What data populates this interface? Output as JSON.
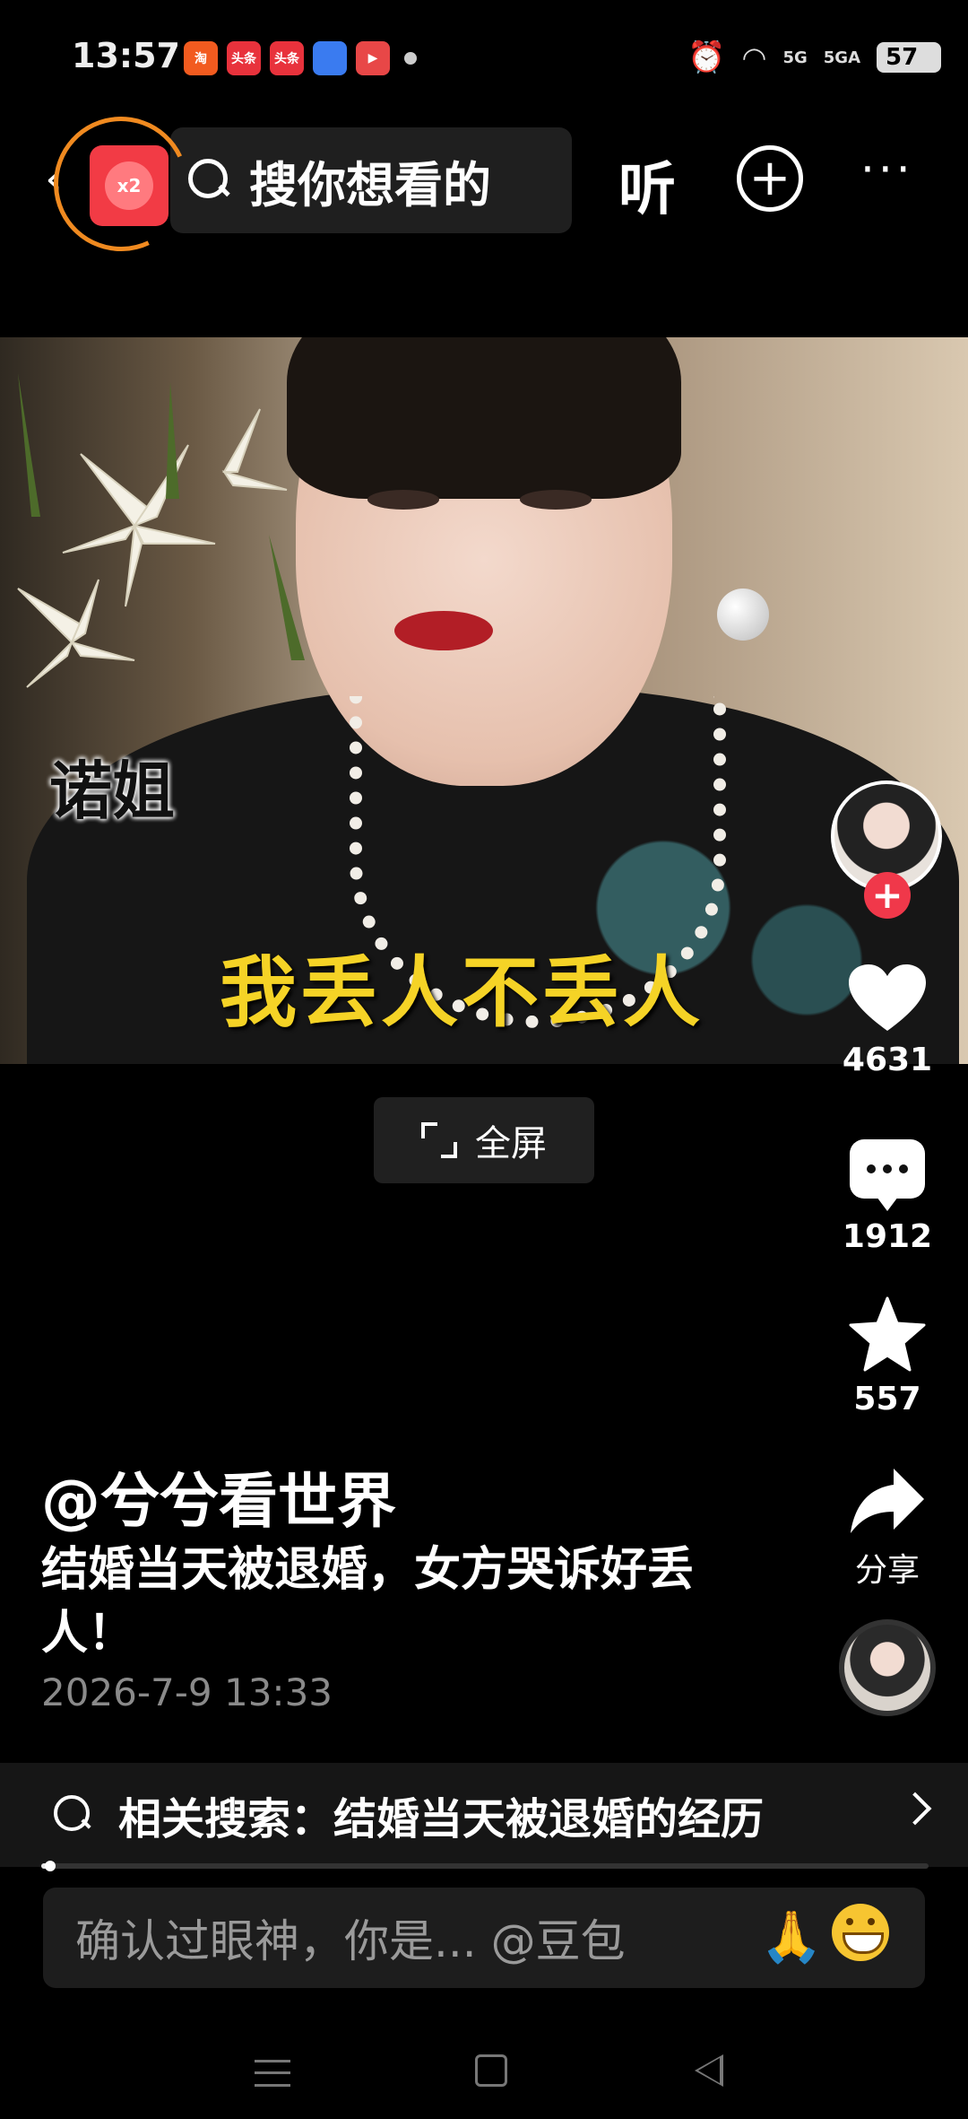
{
  "status_bar": {
    "time": "13:57",
    "apps": [
      {
        "name": "taobao",
        "label": "淘",
        "color": "#f25b1f"
      },
      {
        "name": "toutiao",
        "label": "头条",
        "color": "#e8323c"
      },
      {
        "name": "toutiao-lite",
        "label": "头条",
        "color": "#e8323c"
      },
      {
        "name": "browser",
        "label": "",
        "color": "#3a7bf0"
      },
      {
        "name": "video-app",
        "label": "▶",
        "color": "#e84747"
      }
    ],
    "signal_1": "5G",
    "signal_2": "5GA",
    "battery": "57"
  },
  "top_bar": {
    "redpacket_badge": "x2",
    "search_placeholder": "搜你想看的",
    "listen_label": "听"
  },
  "video": {
    "watermark": "诺姐",
    "subtitle": "我丢人不丢人"
  },
  "fullscreen_label": "全屏",
  "rail": {
    "likes": "4631",
    "comments": "1912",
    "favorites": "557",
    "share_label": "分享"
  },
  "post": {
    "author": "@兮兮看世界",
    "description": "结婚当天被退婚，女方哭诉好丢人！",
    "date": "2026-7-9 13:33"
  },
  "related_search": {
    "text": "相关搜索：结婚当天被退婚的经历"
  },
  "playback_progress": 0.01,
  "comment_input": {
    "placeholder": "确认过眼神，你是... @豆包"
  },
  "colors": {
    "accent_red": "#f0384a",
    "subtitle_yellow": "#f5d326"
  }
}
